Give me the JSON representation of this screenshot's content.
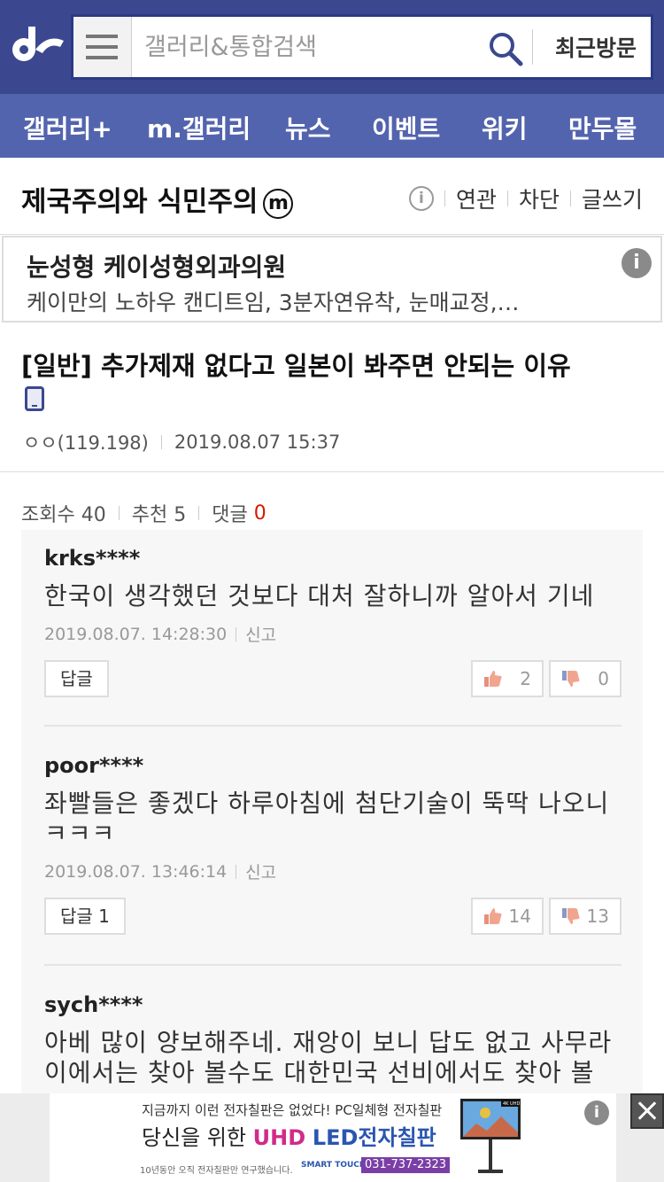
{
  "header": {
    "logo": "dc-logo",
    "search_placeholder": "갤러리&통합검색",
    "recent_label": "최근방문"
  },
  "nav": {
    "items": [
      "갤러리+",
      "m.갤러리",
      "뉴스",
      "이벤트",
      "위키",
      "만두몰"
    ]
  },
  "gallery": {
    "title": "제국주의와 식민주의",
    "minor_badge": "m",
    "tools": [
      "연관",
      "차단",
      "글쓰기"
    ]
  },
  "ad_top": {
    "title": "눈성형 케이성형외과의원",
    "desc": "케이만의 노하우 캔디트임, 3분자연유착, 눈매교정,…"
  },
  "post": {
    "title": "[일반] 추가제재 없다고 일본이 봐주면 안되는 이유",
    "author": "ㅇㅇ(119.198)",
    "date": "2019.08.07 15:37",
    "views_label": "조회수 40",
    "recommend_label": "추천 5",
    "comments_label": "댓글",
    "comments_count": "0"
  },
  "comments": [
    {
      "user": "krks****",
      "text": "한국이 생각했던 것보다 대처 잘하니까 알아서 기네",
      "date": "2019.08.07. 14:28:30",
      "report": "신고",
      "reply": "답글",
      "up": "2",
      "down": "0"
    },
    {
      "user": "poor****",
      "text": "좌빨들은 좋겠다 하루아침에 첨단기술이 뚝딱 나오니 ㅋㅋㅋ",
      "date": "2019.08.07. 13:46:14",
      "report": "신고",
      "reply": "답글 1",
      "up": "14",
      "down": "13"
    },
    {
      "user": "sych****",
      "text": "아베 많이 양보해주네. 재앙이 보니 답도 없고 사무라이에서는 찾아 볼수도 대한민국 선비에서도 찾아 볼"
    }
  ],
  "ad_bottom": {
    "line1": "지금까지 이런 전자칠판은 없었다! PC일체형 전자칠판",
    "line2_prefix": "당신을 위한 ",
    "line2_uhd": "UHD",
    "line2_led": "LED전자칠판",
    "line3": "10년동안 오직 전자칠판만 연구했습니다.",
    "brand": "SMART TOUCH",
    "phone": "031-737-2323",
    "tv_badge": "4K UHD"
  },
  "colors": {
    "topbar": "#3b4890",
    "navbar": "#5364ae",
    "accent_red": "#d31900"
  }
}
